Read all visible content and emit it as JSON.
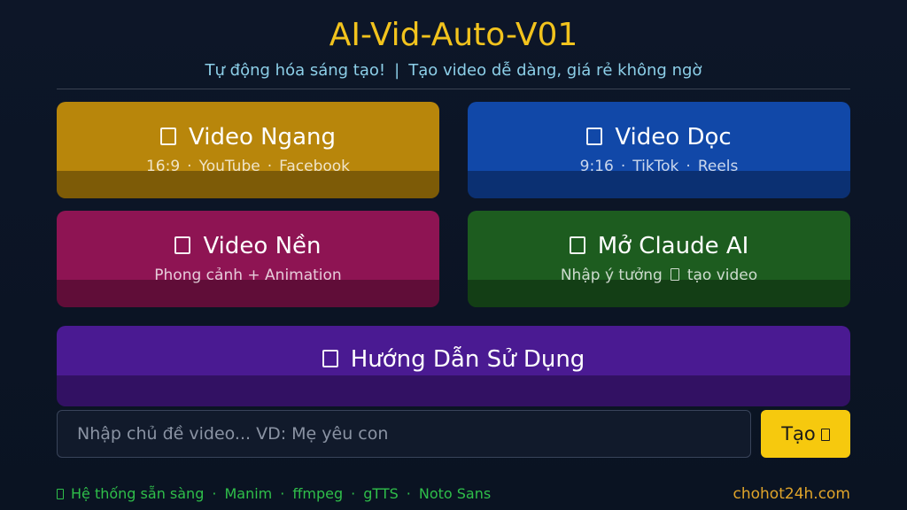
{
  "header": {
    "title": "AI-Vid-Auto-V01",
    "subtitle_left": "Tự động hóa sáng tạo!",
    "subtitle_sep": "|",
    "subtitle_right": "Tạo video dễ dàng, giá rẻ không ngờ"
  },
  "cards": {
    "ngang": {
      "icon": "unknown-glyph-icon",
      "title": "Video Ngang",
      "tags": [
        "16:9",
        "YouTube",
        "Facebook"
      ]
    },
    "doc": {
      "icon": "unknown-glyph-icon",
      "title": "Video Dọc",
      "tags": [
        "9:16",
        "TikTok",
        "Reels"
      ]
    },
    "nen": {
      "icon": "unknown-glyph-icon",
      "title": "Video Nền",
      "subtitle": "Phong cảnh + Animation"
    },
    "claude": {
      "icon": "unknown-glyph-icon",
      "title": "Mở Claude AI",
      "subtitle_left": "Nhập ý tưởng",
      "subtitle_right": "tạo video"
    },
    "huongdan": {
      "icon": "unknown-glyph-icon",
      "title": "Hướng Dẫn Sử Dụng"
    }
  },
  "tag_separator": "·",
  "topic_input": {
    "value": "",
    "placeholder": "Nhập chủ đề video... VD: Mẹ yêu con"
  },
  "create_button": {
    "label": "Tạo",
    "icon": "unknown-glyph-icon"
  },
  "footer": {
    "status": "Hệ thống sẵn sàng",
    "tools": [
      "Manim",
      "ffmpeg",
      "gTTS",
      "Noto Sans"
    ],
    "brand": "chohot24h.com"
  },
  "colors": {
    "title": "#f2c31d",
    "subtitle": "#8ccfe8",
    "card_ngang": "#b8860b",
    "card_doc": "#1148a8",
    "card_nen": "#8e1453",
    "card_claude": "#1d5c1f",
    "card_huongdan": "#4a1a92",
    "create_button": "#f6c90e",
    "status": "#2fbf4a",
    "brand": "#e0a42a"
  }
}
